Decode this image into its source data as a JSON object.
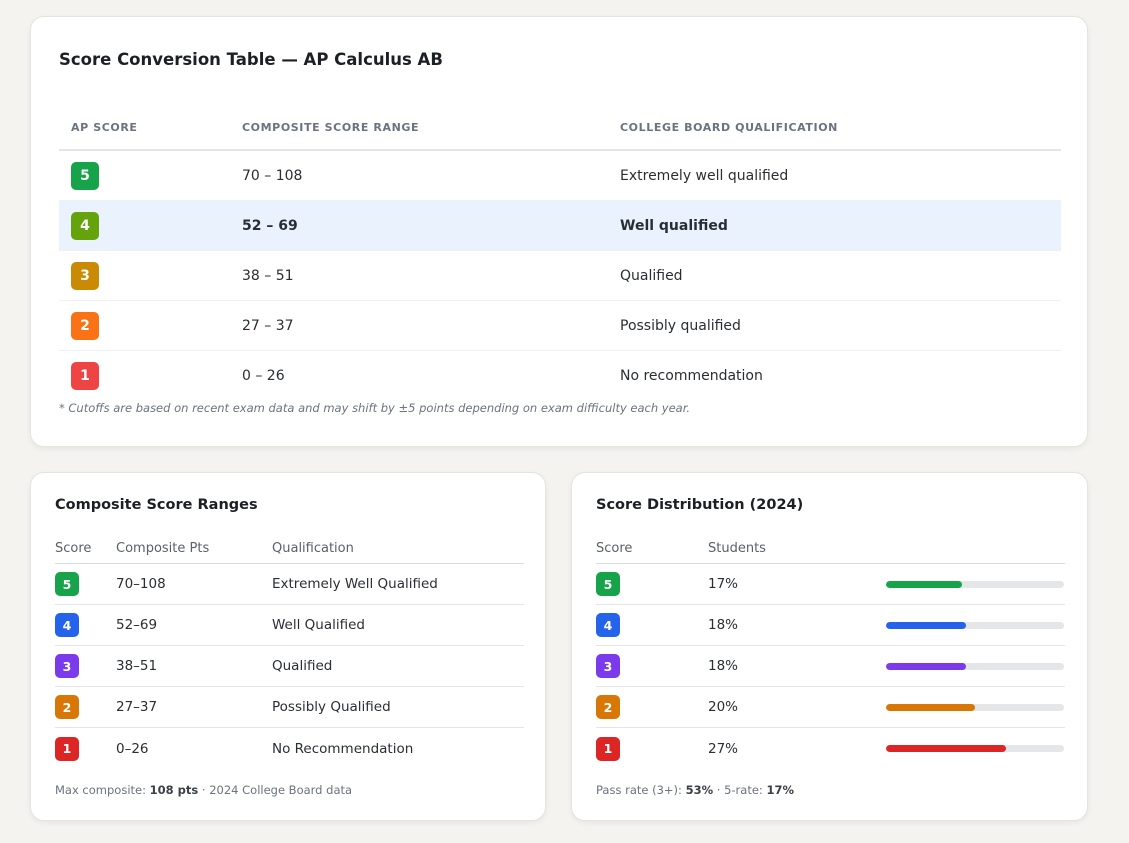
{
  "conversion": {
    "title": "Score Conversion Table — AP Calculus AB",
    "headers": [
      "AP SCORE",
      "COMPOSITE SCORE RANGE",
      "COLLEGE BOARD QUALIFICATION"
    ],
    "rows": [
      {
        "score": "5",
        "range": "70 – 108",
        "qualification": "Extremely well qualified",
        "color": "#16a34a"
      },
      {
        "score": "4",
        "range": "52 – 69",
        "qualification": "Well qualified",
        "color": "#65a30d",
        "highlighted": true
      },
      {
        "score": "3",
        "range": "38 – 51",
        "qualification": "Qualified",
        "color": "#ca8a04"
      },
      {
        "score": "2",
        "range": "27 – 37",
        "qualification": "Possibly qualified",
        "color": "#f97316"
      },
      {
        "score": "1",
        "range": "0 – 26",
        "qualification": "No recommendation",
        "color": "#ef4444"
      }
    ],
    "footnote": "* Cutoffs are based on recent exam data and may shift by ±5 points depending on exam difficulty each year."
  },
  "ranges": {
    "title": "Composite Score Ranges",
    "headers": [
      "Score",
      "Composite Pts",
      "Qualification"
    ],
    "rows": [
      {
        "score": "5",
        "pts": "70–108",
        "qualification": "Extremely Well Qualified",
        "color": "#16a34a"
      },
      {
        "score": "4",
        "pts": "52–69",
        "qualification": "Well Qualified",
        "color": "#2563eb"
      },
      {
        "score": "3",
        "pts": "38–51",
        "qualification": "Qualified",
        "color": "#7c3aed"
      },
      {
        "score": "2",
        "pts": "27–37",
        "qualification": "Possibly Qualified",
        "color": "#d97706"
      },
      {
        "score": "1",
        "pts": "0–26",
        "qualification": "No Recommendation",
        "color": "#dc2626"
      }
    ],
    "footer": {
      "label": "Max composite: ",
      "value": "108 pts",
      "suffix": " · 2024 College Board data"
    }
  },
  "distribution": {
    "title": "Score Distribution (2024)",
    "headers": [
      "Score",
      "Students"
    ],
    "rows": [
      {
        "score": "5",
        "students": "17%",
        "percent": 17,
        "color": "#16a34a"
      },
      {
        "score": "4",
        "students": "18%",
        "percent": 18,
        "color": "#2563eb"
      },
      {
        "score": "3",
        "students": "18%",
        "percent": 18,
        "color": "#7c3aed"
      },
      {
        "score": "2",
        "students": "20%",
        "percent": 20,
        "color": "#d97706"
      },
      {
        "score": "1",
        "students": "27%",
        "percent": 27,
        "color": "#dc2626"
      }
    ],
    "footer": {
      "label1": "Pass rate (3+): ",
      "value1": "53%",
      "sep": " · 5-rate: ",
      "value2": "17%"
    }
  }
}
